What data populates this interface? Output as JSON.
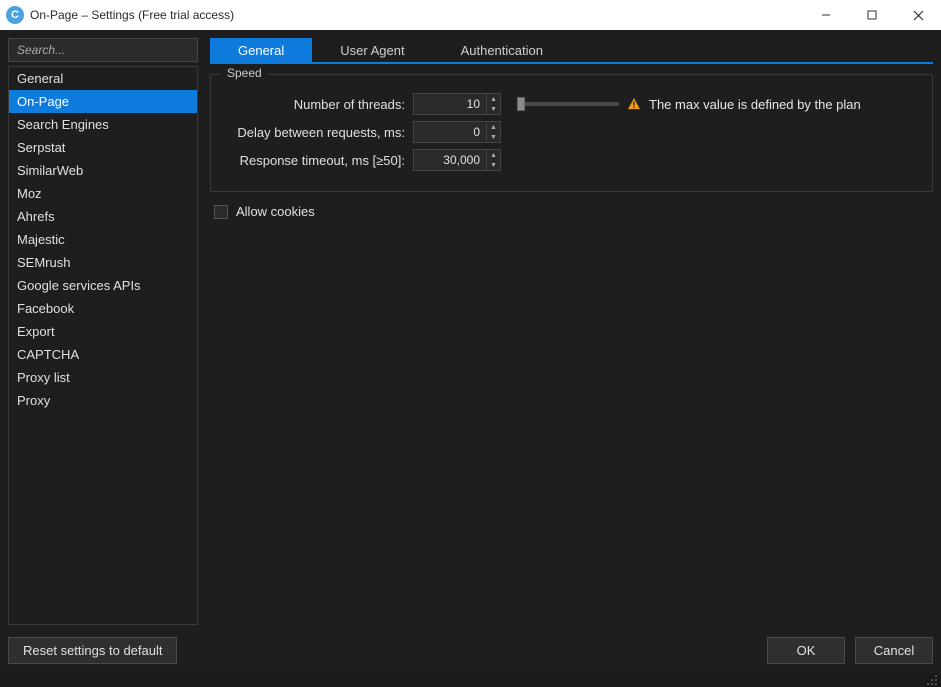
{
  "window": {
    "title": "On-Page – Settings (Free trial access)"
  },
  "sidebar": {
    "search_placeholder": "Search...",
    "items": [
      {
        "label": "General",
        "selected": false
      },
      {
        "label": "On-Page",
        "selected": true
      },
      {
        "label": "Search Engines",
        "selected": false
      },
      {
        "label": "Serpstat",
        "selected": false
      },
      {
        "label": "SimilarWeb",
        "selected": false
      },
      {
        "label": "Moz",
        "selected": false
      },
      {
        "label": "Ahrefs",
        "selected": false
      },
      {
        "label": "Majestic",
        "selected": false
      },
      {
        "label": "SEMrush",
        "selected": false
      },
      {
        "label": "Google services APIs",
        "selected": false
      },
      {
        "label": "Facebook",
        "selected": false
      },
      {
        "label": "Export",
        "selected": false
      },
      {
        "label": "CAPTCHA",
        "selected": false
      },
      {
        "label": "Proxy list",
        "selected": false
      },
      {
        "label": "Proxy",
        "selected": false
      }
    ]
  },
  "tabs": [
    {
      "label": "General",
      "active": true
    },
    {
      "label": "User Agent",
      "active": false
    },
    {
      "label": "Authentication",
      "active": false
    }
  ],
  "speed_group": {
    "legend": "Speed",
    "threads_label": "Number of threads:",
    "threads_value": "10",
    "delay_label": "Delay between requests, ms:",
    "delay_value": "0",
    "timeout_label": "Response timeout, ms [≥50]:",
    "timeout_value": "30,000",
    "warning_text": "The max value is defined by the plan"
  },
  "allow_cookies_label": "Allow cookies",
  "footer": {
    "reset_label": "Reset settings to default",
    "ok_label": "OK",
    "cancel_label": "Cancel"
  }
}
